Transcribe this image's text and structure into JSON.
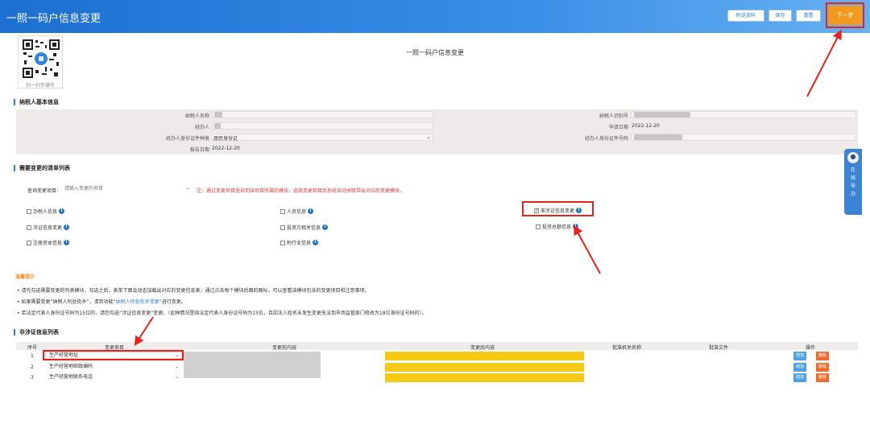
{
  "header": {
    "title": "一照一码户信息变更",
    "buttons": {
      "attach": "附送资料",
      "save": "保存",
      "reset": "重置",
      "next": "下一步"
    }
  },
  "qr": {
    "caption": "扫一扫手操作"
  },
  "page_title": "一照一码户信息变更",
  "basic": {
    "section_title": "纳税人基本信息",
    "taxpayer_name_label": "纳税人名称",
    "taxpayer_id_label": "纳税人识别号",
    "operator_label": "经办人",
    "apply_date_label": "申请日期",
    "apply_date_value": "2022-12-20",
    "id_type_label": "经办人身份证件种类",
    "id_type_value": "居民身份证",
    "id_no_label": "经办人身份证件号码",
    "report_date_label": "报告日期",
    "report_date_value": "2022-12-20"
  },
  "change_list": {
    "section_title": "需要变更的清单列表",
    "query_label": "查询变更项目：",
    "query_placeholder": "请输入变更的项目",
    "note": "注：通过变更项目查询到该项目所属的模块，选择变更项目后系统自动关联带出对应的变更模块。",
    "items": [
      {
        "label": "办税人信息",
        "checked": false
      },
      {
        "label": "人员信息",
        "checked": false
      },
      {
        "label": "非涉证信息变更",
        "checked": true
      },
      {
        "label": "涉证信息变更",
        "checked": false
      },
      {
        "label": "投资方相关信息",
        "checked": false
      },
      {
        "label": "投资总额信息",
        "checked": false
      },
      {
        "label": "注册资本信息",
        "checked": false
      },
      {
        "label": "附行业信息",
        "checked": false
      }
    ]
  },
  "tips": {
    "title": "温馨提示",
    "line1": "• 请先勾选需要变更的列表模块，勾选之后，表单下面会动态加载出对应的变更信息表；通过点击每个模块后面的图标，可以查看该模块包含的变更项目和注意事项。",
    "line2_pre": "• 如果需要变更“纳税人所处街乡”，请到功能“",
    "line2_link": "纳税人所处街乡变更",
    "line2_post": "”进行变更。",
    "line3": "• 若法定代表人身份证号码为15位的，请您勾选“涉证信息变更”变更。（此种情况是指法定代表人身份证号码为15位，且因法人姓名未发生变更无法到市场监管部门修改为18位身份证号码的）。"
  },
  "table": {
    "section_title": "非涉证信息列表",
    "headers": [
      "序号",
      "变更项目",
      "变更前内容",
      "变更后内容",
      "批准机关名称",
      "批准文件",
      "操作"
    ],
    "rows": [
      {
        "no": "1",
        "item": "生产经营地址",
        "add": "增加",
        "del": "删除"
      },
      {
        "no": "2",
        "item": "生产经营地邮政编码",
        "add": "增加",
        "del": "删除"
      },
      {
        "no": "3",
        "item": "生产经营地联系电话",
        "add": "增加",
        "del": "删除"
      }
    ]
  },
  "side_widget": {
    "chars": [
      "在",
      "线",
      "导",
      "办"
    ]
  },
  "colors": {
    "header": "#2f7fd6",
    "accent_orange": "#f39a1e",
    "highlight_red": "#e8231e",
    "after_value_yellow": "#f6c915"
  }
}
